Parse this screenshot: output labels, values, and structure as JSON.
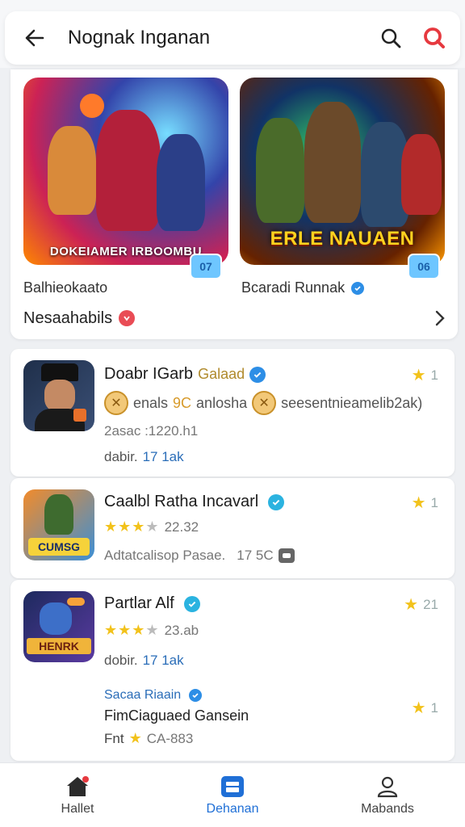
{
  "header": {
    "title": "Nognak Inganan",
    "back_icon": "arrow-left-icon",
    "search_icon": "search-icon",
    "brand_search_icon": "search-icon-red",
    "accent_color": "#e6393f"
  },
  "featured": {
    "items": [
      {
        "banner": "DOKEIAMER IRBOOMBU",
        "badge": "07",
        "name": "Balhieokaato",
        "verified": false
      },
      {
        "banner": "ERLE NAUAEN",
        "badge": "06",
        "name": "Bcaradi Runnak",
        "verified": true
      }
    ],
    "section": {
      "title": "Nesaahabils"
    }
  },
  "apps": [
    {
      "title": "Doabr IGarb",
      "title_sub": "Galaad",
      "verified": true,
      "rating": "1",
      "features": [
        "enals",
        "anlosha",
        "seesentnieamelib2ak)"
      ],
      "feature_mid": "9C",
      "meta1": "2asac :1220.h1",
      "meta2_label": "dabir.",
      "meta2_value": "17 1ak"
    },
    {
      "title": "Caalbl Ratha Incavarl",
      "verified": true,
      "rating": "1",
      "stars": 3,
      "score": "22.32",
      "meta1": "Adtatcalisop Pasae.",
      "meta1_value": "17 5C",
      "icon_label": "CUMSG"
    },
    {
      "title": "Partlar Alf",
      "verified": true,
      "rating": "21",
      "stars": 3,
      "score": "23.ab",
      "meta2_label": "dobir.",
      "meta2_value": "17 1ak",
      "icon_label": "HENRK",
      "extra": {
        "dev": "Sacaa Riaain",
        "line": "FimCiaguaed Gansein",
        "footer_label": "Fnt",
        "footer_value": "CA-883",
        "rating": "1"
      }
    }
  ],
  "bottom_nav": [
    {
      "label": "Hallet",
      "icon": "home-icon",
      "active": false
    },
    {
      "label": "Dehanan",
      "icon": "store-icon",
      "active": true
    },
    {
      "label": "Mabands",
      "icon": "profile-icon",
      "active": false
    }
  ]
}
